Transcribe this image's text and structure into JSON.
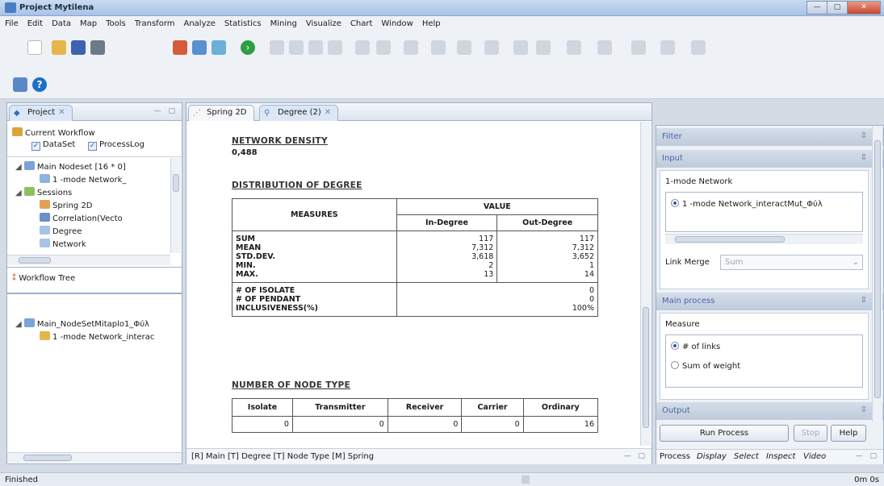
{
  "window": {
    "title": "Project Mytilena",
    "min": "—",
    "max": "▢",
    "close": "✕"
  },
  "menu": [
    "File",
    "Edit",
    "Data",
    "Map",
    "Tools",
    "Transform",
    "Analyze",
    "Statistics",
    "Mining",
    "Visualize",
    "Chart",
    "Window",
    "Help"
  ],
  "project_panel": {
    "tab": "Project",
    "current_workflow": "Current Workflow",
    "dataset": "DataSet",
    "processlog": "ProcessLog",
    "main_nodeset": "Main Nodeset [16 * 0]",
    "one_mode_network": "1 -mode Network_",
    "sessions": "Sessions",
    "sessions_items": [
      "Spring 2D",
      "Correlation(Vecto",
      "Degree",
      "Network"
    ]
  },
  "workflow_tree": {
    "title": "Workflow Tree",
    "root": "Main_NodeSetMitaplo1_Φύλ",
    "child": "1 -mode Network_interac"
  },
  "editor_tabs": [
    {
      "label": "Spring 2D"
    },
    {
      "label": "Degree (2)"
    }
  ],
  "report": {
    "density_heading": "NETWORK DENSITY",
    "density_value": "0,488",
    "distribution_heading": "DISTRIBUTION OF DEGREE",
    "table": {
      "measures_header": "MEASURES",
      "value_header": "VALUE",
      "in_header": "In-Degree",
      "out_header": "Out-Degree",
      "labels1": [
        "SUM",
        "MEAN",
        "STD.DEV.",
        "MIN.",
        "MAX."
      ],
      "in_values": [
        "117",
        "7,312",
        "3,618",
        "2",
        "13"
      ],
      "out_values": [
        "117",
        "7,312",
        "3,652",
        "1",
        "14"
      ],
      "labels2": [
        "# OF ISOLATE",
        "# OF PENDANT",
        "INCLUSIVENESS(%)"
      ],
      "values2": [
        "0",
        "0",
        "100%"
      ]
    },
    "node_type_heading": "NUMBER OF NODE TYPE",
    "node_type_headers": [
      "Isolate",
      "Transmitter",
      "Receiver",
      "Carrier",
      "Ordinary"
    ],
    "node_type_values": [
      "0",
      "0",
      "0",
      "0",
      "16"
    ]
  },
  "bottom_tabs": "[R] Main  [T] Degree  [T] Node Type  [M] Spring",
  "side": {
    "filter": "Filter",
    "input": "Input",
    "input_group": "1-mode Network",
    "input_option": "1 -mode Network_interactMut_Φύλ",
    "link_merge_label": "Link Merge",
    "link_merge_value": "Sum",
    "main_process": "Main process",
    "measure_label": "Measure",
    "measure_option1": "# of links",
    "measure_option2": "Sum of weight",
    "output": "Output",
    "run": "Run Process",
    "stop": "Stop",
    "help": "Help",
    "tabs": [
      "Process",
      "Display",
      "Select",
      "Inspect",
      "Video"
    ]
  },
  "status": {
    "left": "Finished",
    "right": "0m 0s"
  }
}
